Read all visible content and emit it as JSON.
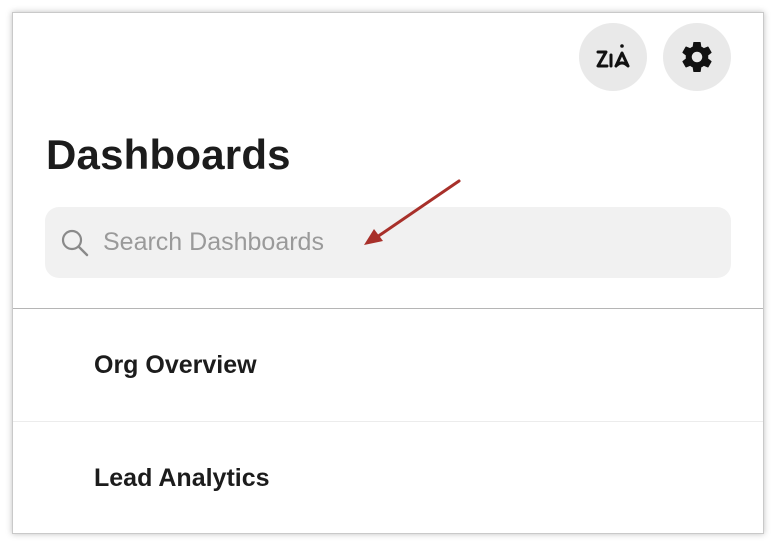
{
  "header": {
    "zia_button": {
      "icon": "zia-icon"
    },
    "settings_button": {
      "icon": "gear-icon"
    }
  },
  "page_title": "Dashboards",
  "search": {
    "placeholder": "Search Dashboards",
    "value": ""
  },
  "dashboards": [
    {
      "label": "Org Overview"
    },
    {
      "label": "Lead Analytics"
    }
  ],
  "colors": {
    "button_bg": "#e9e9e9",
    "search_bg": "#f1f1f1",
    "annotation_arrow": "#a8302a"
  }
}
